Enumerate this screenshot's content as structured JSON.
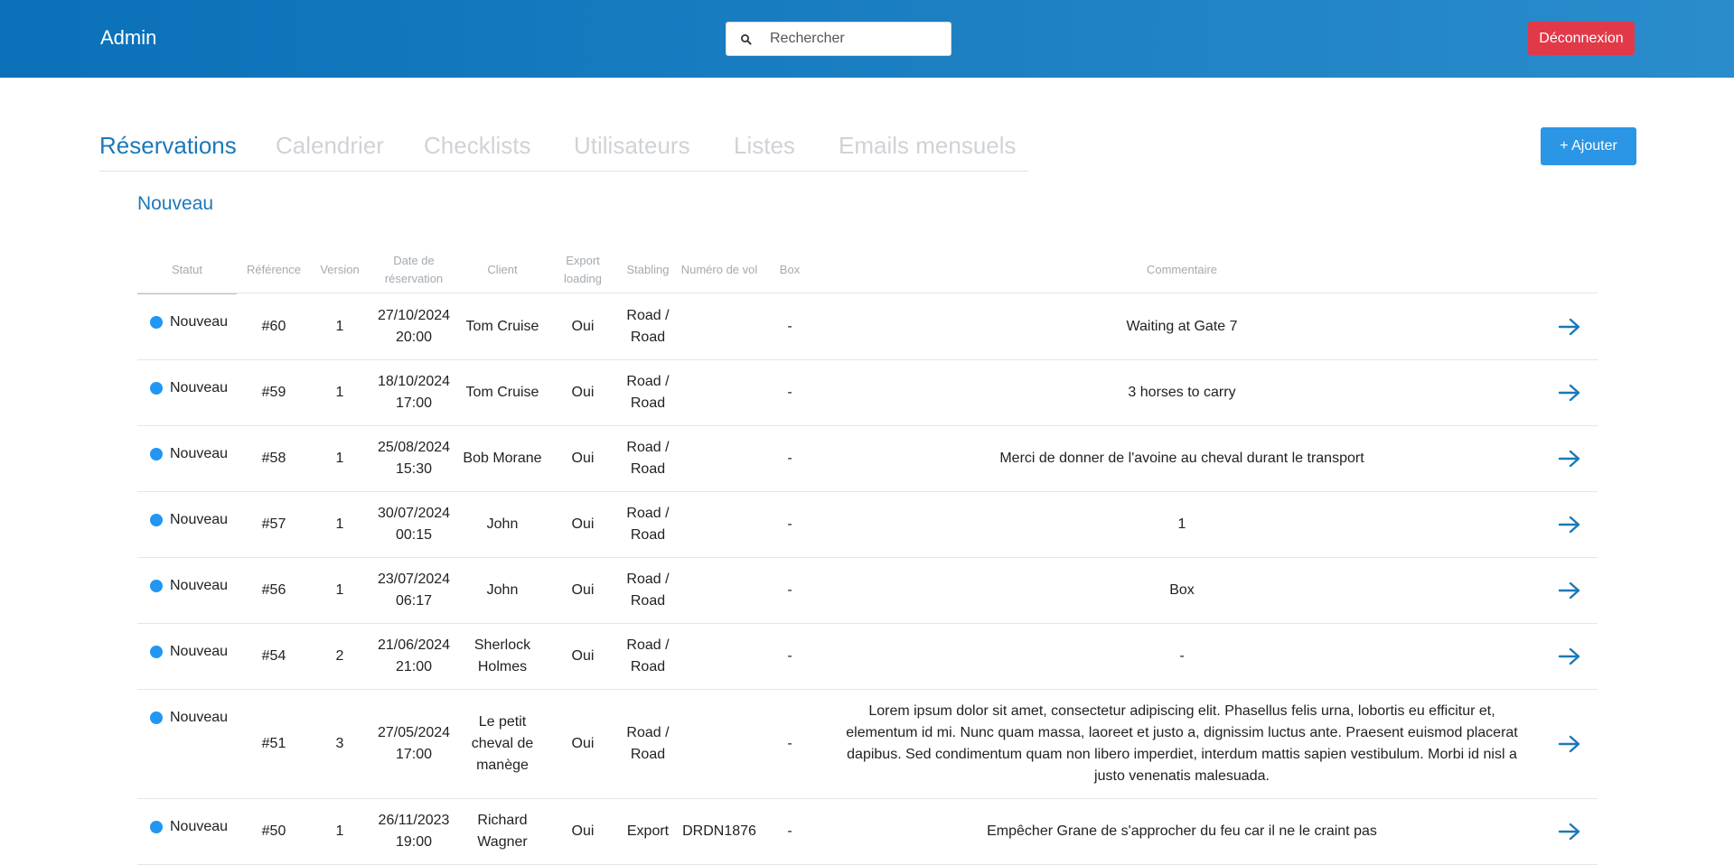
{
  "header": {
    "brand": "Admin",
    "search_placeholder": "Rechercher",
    "logout_label": "Déconnexion"
  },
  "tabs": [
    {
      "label": "Réservations",
      "active": true
    },
    {
      "label": "Calendrier",
      "active": false
    },
    {
      "label": "Checklists",
      "active": false
    },
    {
      "label": "Utilisateurs",
      "active": false
    },
    {
      "label": "Listes",
      "active": false
    },
    {
      "label": "Emails mensuels",
      "active": false
    }
  ],
  "add_button_label": "+ Ajouter",
  "section_title": "Nouveau",
  "table": {
    "columns": [
      "Statut",
      "Référence",
      "Version",
      "Date de réservation",
      "Client",
      "Export loading",
      "Stabling",
      "Numéro de vol",
      "Box",
      "Commentaire"
    ],
    "rows": [
      {
        "status": "Nouveau",
        "ref": "#60",
        "version": "1",
        "date": "27/10/2024 20:00",
        "client": "Tom Cruise",
        "export": "Oui",
        "stabling": "Road / Road",
        "flight": "",
        "box": "-",
        "comment": "Waiting at Gate 7"
      },
      {
        "status": "Nouveau",
        "ref": "#59",
        "version": "1",
        "date": "18/10/2024 17:00",
        "client": "Tom Cruise",
        "export": "Oui",
        "stabling": "Road / Road",
        "flight": "",
        "box": "-",
        "comment": "3 horses to carry"
      },
      {
        "status": "Nouveau",
        "ref": "#58",
        "version": "1",
        "date": "25/08/2024 15:30",
        "client": "Bob Morane",
        "export": "Oui",
        "stabling": "Road / Road",
        "flight": "",
        "box": "-",
        "comment": "Merci de donner de l'avoine au cheval durant le transport"
      },
      {
        "status": "Nouveau",
        "ref": "#57",
        "version": "1",
        "date": "30/07/2024 00:15",
        "client": "John",
        "export": "Oui",
        "stabling": "Road / Road",
        "flight": "",
        "box": "-",
        "comment": "1"
      },
      {
        "status": "Nouveau",
        "ref": "#56",
        "version": "1",
        "date": "23/07/2024 06:17",
        "client": "John",
        "export": "Oui",
        "stabling": "Road / Road",
        "flight": "",
        "box": "-",
        "comment": "Box"
      },
      {
        "status": "Nouveau",
        "ref": "#54",
        "version": "2",
        "date": "21/06/2024 21:00",
        "client": "Sherlock Holmes",
        "export": "Oui",
        "stabling": "Road / Road",
        "flight": "",
        "box": "-",
        "comment": "-"
      },
      {
        "status": "Nouveau",
        "ref": "#51",
        "version": "3",
        "date": "27/05/2024 17:00",
        "client": "Le petit cheval de manège",
        "export": "Oui",
        "stabling": "Road / Road",
        "flight": "",
        "box": "-",
        "comment": "Lorem ipsum dolor sit amet, consectetur adipiscing elit. Phasellus felis urna, lobortis eu efficitur et, elementum id mi. Nunc quam massa, laoreet et justo a, dignissim luctus ante. Praesent euismod placerat dapibus. Sed condimentum quam non libero imperdiet, interdum mattis sapien vestibulum. Morbi id nisl a justo venenatis malesuada."
      },
      {
        "status": "Nouveau",
        "ref": "#50",
        "version": "1",
        "date": "26/11/2023 19:00",
        "client": "Richard Wagner",
        "export": "Oui",
        "stabling": "Export",
        "flight": "DRDN1876",
        "box": "-",
        "comment": "Empêcher Grane de s'approcher du feu car il ne le craint pas"
      }
    ]
  },
  "colors": {
    "header_start": "#0a70b8",
    "header_end": "#2a8ccb",
    "accent": "#1a79b8",
    "logout": "#e23948",
    "add": "#2b95e6",
    "status_dot": "#2196f3"
  },
  "icons": {
    "search": "search-icon",
    "row_action": "arrow-right-icon"
  }
}
